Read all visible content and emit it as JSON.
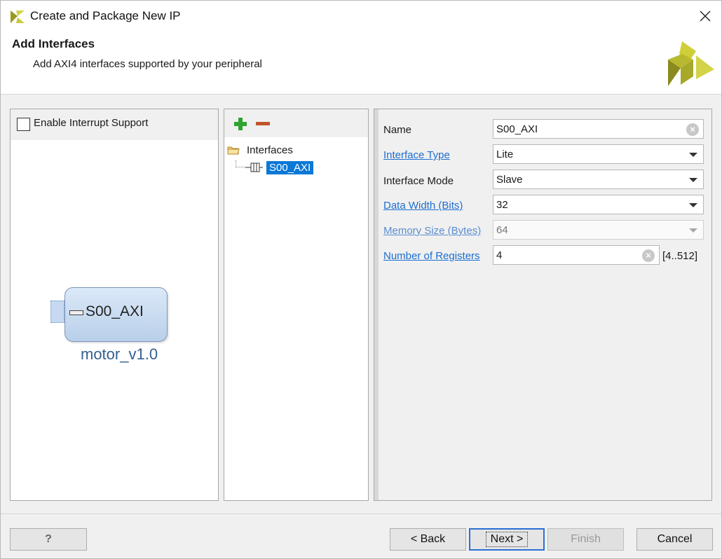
{
  "window": {
    "title": "Create and Package New IP"
  },
  "header": {
    "title": "Add Interfaces",
    "subtitle": "Add AXI4 interfaces supported by your peripheral"
  },
  "left_panel": {
    "interrupt_checkbox_label": "Enable Interrupt Support",
    "interrupt_checked": false,
    "ip_port_label": "S00_AXI",
    "ip_name": "motor_v1.0"
  },
  "middle_panel": {
    "tree_root": "Interfaces",
    "tree_items": [
      "S00_AXI"
    ]
  },
  "properties": {
    "name_label": "Name",
    "name_value": "S00_AXI",
    "interface_type_label": "Interface Type",
    "interface_type_value": "Lite",
    "interface_mode_label": "Interface Mode",
    "interface_mode_value": "Slave",
    "data_width_label": "Data Width (Bits)",
    "data_width_value": "32",
    "memory_size_label": "Memory Size (Bytes)",
    "memory_size_value": "64",
    "num_registers_label": "Number of Registers",
    "num_registers_value": "4",
    "num_registers_range": "[4..512]"
  },
  "footer": {
    "help": "?",
    "back": "< Back",
    "next": "Next >",
    "finish": "Finish",
    "cancel": "Cancel"
  },
  "colors": {
    "selection": "#0a78d7",
    "link": "#1d6ed0",
    "add_icon": "#2ea32e",
    "remove_icon": "#c0552a",
    "logo_dark": "#8a8a1e",
    "logo_light": "#d3d34a",
    "ip_name": "#34608f"
  }
}
